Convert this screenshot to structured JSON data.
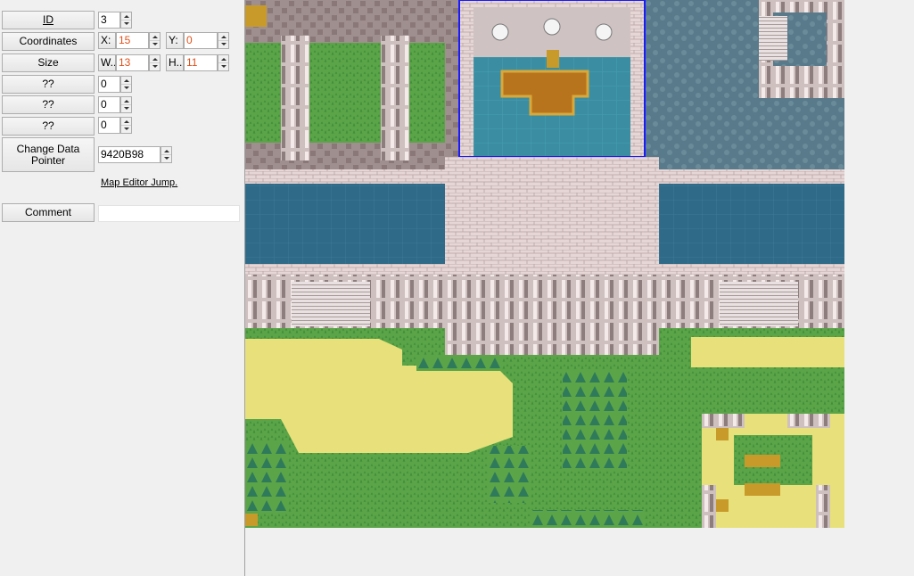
{
  "fields": {
    "id": {
      "label": "ID",
      "value": "3"
    },
    "coordinates": {
      "label": "Coordinates",
      "x_label": "X:",
      "x_value": "15",
      "y_label": "Y:",
      "y_value": "0"
    },
    "size": {
      "label": "Size",
      "w_label": "W...",
      "w_value": "13",
      "h_label": "H...",
      "h_value": "11"
    },
    "unknown1": {
      "label": "??",
      "value": "0"
    },
    "unknown2": {
      "label": "??",
      "value": "0"
    },
    "unknown3": {
      "label": "??",
      "value": "0"
    },
    "pointer": {
      "label": "Change Data Pointer",
      "value": "9420B98"
    },
    "comment": {
      "label": "Comment",
      "value": ""
    }
  },
  "map_editor_link": "Map Editor Jump.",
  "colors": {
    "accent_value": "#e0501a",
    "selection_box": "#1a1aff",
    "grass": "#5aa445",
    "sand": "#e8e07a",
    "water": "#2a6a8a",
    "stone": "#e8d8d8",
    "roof": "#9e8c8c",
    "carpet": "#b8741c"
  },
  "icons": [
    "spin-up-icon",
    "spin-down-icon"
  ]
}
